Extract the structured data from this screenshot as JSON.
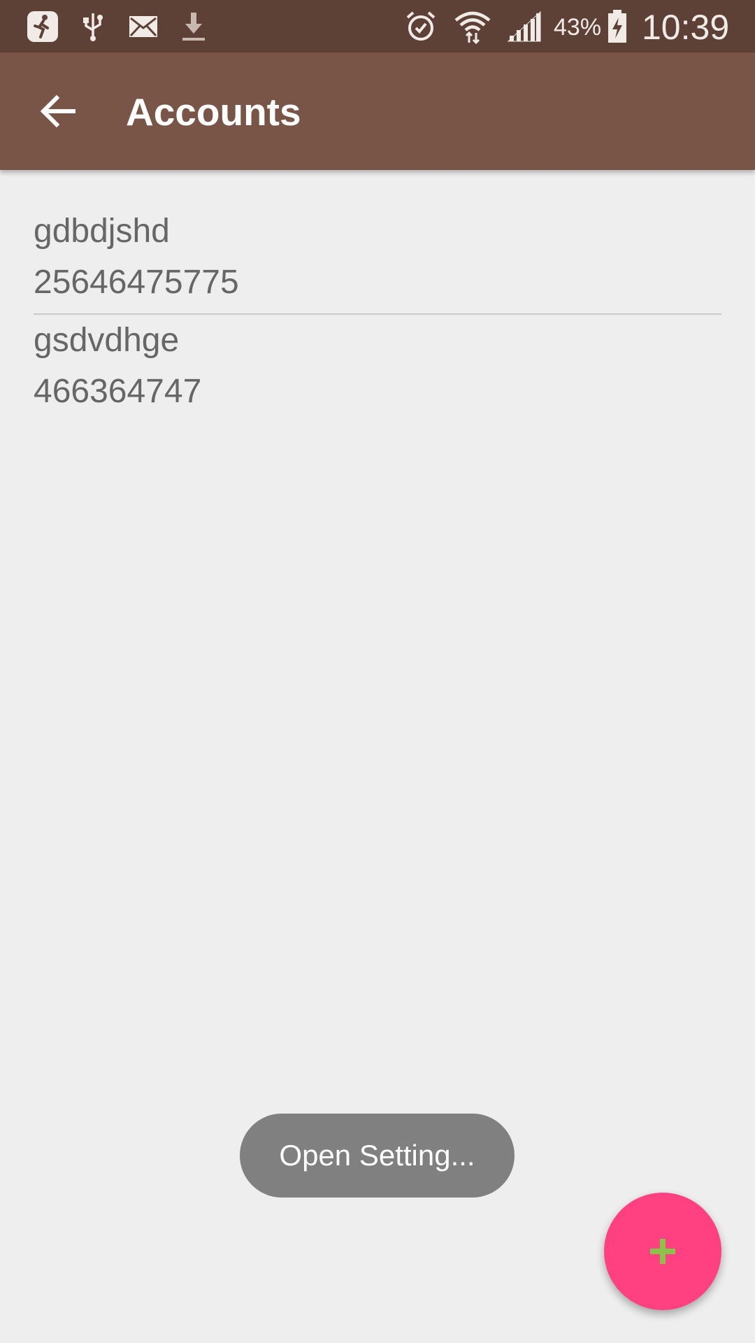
{
  "status_bar": {
    "battery_percent": "43%",
    "time": "10:39",
    "icons": [
      "fitness-app-icon",
      "usb-icon",
      "email-icon",
      "download-icon",
      "alarm-icon",
      "wifi-icon",
      "signal-icon",
      "battery-charging-icon"
    ]
  },
  "app_bar": {
    "title": "Accounts",
    "back_icon": "arrow-back-icon"
  },
  "accounts": [
    {
      "name": "gdbdjshd",
      "number": "25646475775"
    },
    {
      "name": "gsdvdhge",
      "number": "466364747"
    }
  ],
  "toast": {
    "message": "Open Setting..."
  },
  "fab": {
    "icon": "plus-icon"
  },
  "colors": {
    "status_bar": "#5d4036",
    "app_bar": "#795548",
    "background": "#eeeeef",
    "fab": "#ff4081",
    "fab_icon": "#8bc34a",
    "toast": "#808080"
  }
}
